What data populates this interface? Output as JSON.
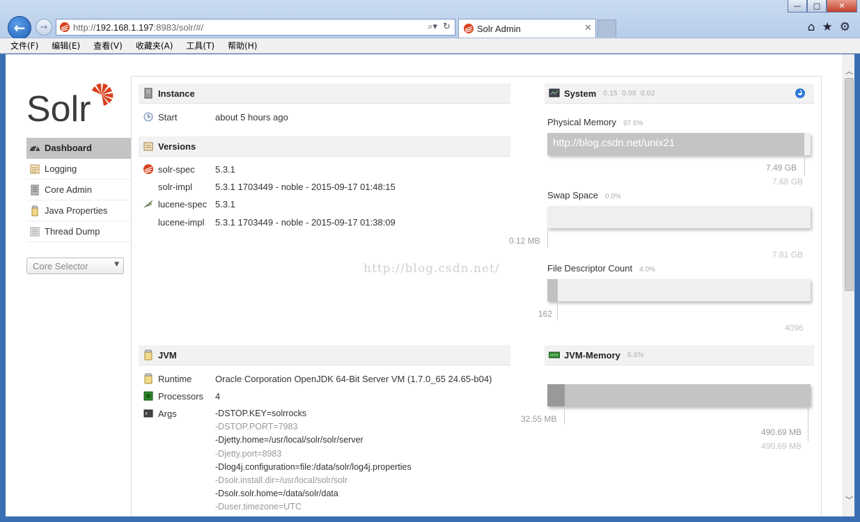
{
  "browser": {
    "url_prefix": "http://",
    "url_host": "192.168.1.197",
    "url_rest": ":8983/solr/#/",
    "tab_title": "Solr Admin",
    "window_buttons": [
      "—",
      "□",
      "✕"
    ]
  },
  "menu": [
    "文件(F)",
    "编辑(E)",
    "查看(V)",
    "收藏夹(A)",
    "工具(T)",
    "帮助(H)"
  ],
  "sidebar": {
    "items": [
      {
        "label": "Dashboard",
        "active": true
      },
      {
        "label": "Logging"
      },
      {
        "label": "Core Admin"
      },
      {
        "label": "Java Properties"
      },
      {
        "label": "Thread Dump"
      }
    ],
    "core_selector_placeholder": "Core Selector"
  },
  "instance": {
    "title": "Instance",
    "start_label": "Start",
    "start_value": "about 5 hours ago"
  },
  "versions": {
    "title": "Versions",
    "rows": [
      {
        "label": "solr-spec",
        "value": "5.3.1"
      },
      {
        "label": "solr-impl",
        "value": "5.3.1 1703449 - noble - 2015-09-17 01:48:15"
      },
      {
        "label": "lucene-spec",
        "value": "5.3.1"
      },
      {
        "label": "lucene-impl",
        "value": "5.3.1 1703449 - noble - 2015-09-17 01:38:09"
      }
    ]
  },
  "system": {
    "title": "System",
    "load": [
      "0.15",
      "0.08",
      "0.02"
    ],
    "physical_memory": {
      "label": "Physical Memory",
      "pct": "97.6%",
      "used": "7.49 GB",
      "total": "7.68 GB",
      "fraction": 0.976
    },
    "swap_space": {
      "label": "Swap Space",
      "pct": "0.0%",
      "used": "0.12 MB",
      "total": "7.81 GB",
      "fraction": 0.0
    },
    "file_descriptors": {
      "label": "File Descriptor Count",
      "pct": "4.0%",
      "used": "162",
      "total": "4096",
      "fraction": 0.04
    }
  },
  "watermark_overlay": "http://blog.csdn.net/unix21",
  "watermark_page": "http://blog.csdn.net/",
  "jvm": {
    "title": "JVM",
    "runtime_label": "Runtime",
    "runtime_value": "Oracle Corporation OpenJDK 64-Bit Server VM (1.7.0_65 24.65-b04)",
    "processors_label": "Processors",
    "processors_value": "4",
    "args_label": "Args",
    "args": [
      "-DSTOP.KEY=solrrocks",
      "-DSTOP.PORT=7983",
      "-Djetty.home=/usr/local/solr/solr/server",
      "-Djetty.port=8983",
      "-Dlog4j.configuration=file:/data/solr/log4j.properties",
      "-Dsolr.install.dir=/usr/local/solr/solr",
      "-Dsolr.solr.home=/data/solr/data",
      "-Duser.timezone=UTC"
    ]
  },
  "jvm_memory": {
    "title": "JVM-Memory",
    "pct": "6.6%",
    "used": "32.55 MB",
    "total_a": "490.69 MB",
    "total_b": "490.69 MB",
    "fraction_used": 0.066
  },
  "colors": {
    "solr_orange": "#d9411e",
    "accent_blue": "#2d7ad6"
  }
}
